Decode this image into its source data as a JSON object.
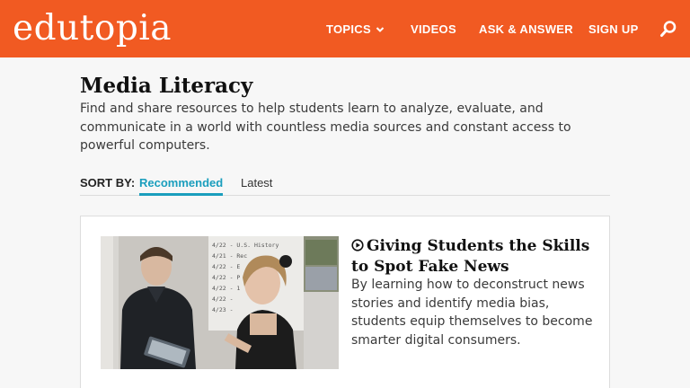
{
  "header": {
    "logo_text": "edutopia",
    "brand_color": "#f15a22",
    "nav": [
      {
        "label": "TOPICS",
        "has_dropdown": true
      },
      {
        "label": "VIDEOS"
      },
      {
        "label": "ASK & ANSWER"
      },
      {
        "label": "SIGN UP"
      }
    ],
    "search_icon": "search-icon"
  },
  "main": {
    "title": "Media Literacy",
    "description": "Find and share resources to help students learn to analyze, evaluate, and communicate in a world with countless media sources and constant access to powerful computers."
  },
  "sort": {
    "label": "SORT BY:",
    "options": [
      {
        "label": "Recommended",
        "active": true
      },
      {
        "label": "Latest",
        "active": false
      }
    ],
    "accent_color": "#1a9ebd"
  },
  "cards": [
    {
      "title": "Giving Students the Skills to Spot Fake News",
      "type_icon": "play-circle-icon",
      "description": "By learning how to deconstruct news stories and identify media bias, students equip themselves to become smarter digital consumers.",
      "whiteboard_text": [
        "4/22 - U.S. History",
        "4/21 - Rec",
        "4/22 - E",
        "4/22 - P",
        "4/22 - 1",
        "4/22 -",
        "4/23 -"
      ]
    }
  ]
}
